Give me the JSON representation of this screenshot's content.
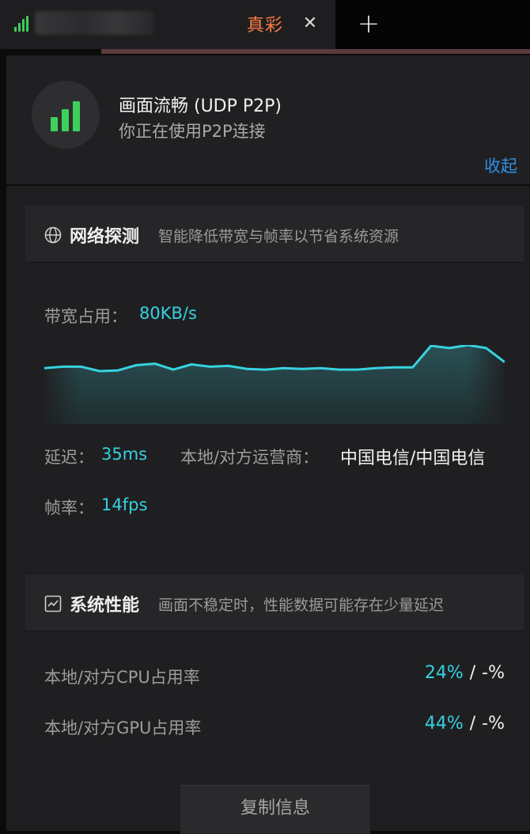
{
  "tab": {
    "title": "真彩",
    "close_glyph": "✕",
    "new_glyph": "+"
  },
  "connection": {
    "title": "画面流畅 (UDP P2P)",
    "subtitle": "你正在使用P2P连接",
    "collapse_label": "收起",
    "signal_icon": "signal-bars-icon",
    "signal_color": "#3fd05a"
  },
  "network": {
    "icon": "globe-icon",
    "title": "网络探测",
    "hint": "智能降低带宽与帧率以节省系统资源",
    "bandwidth_label": "带宽占用：",
    "bandwidth_value": "80KB/s",
    "latency_label": "延迟：",
    "latency_value": "35ms",
    "isp_label": "本地/对方运营商：",
    "isp_value": "中国电信/中国电信",
    "fps_label": "帧率：",
    "fps_value": "14fps",
    "bandwidth_trend": [
      0.54,
      0.56,
      0.56,
      0.5,
      0.51,
      0.58,
      0.6,
      0.52,
      0.59,
      0.56,
      0.57,
      0.53,
      0.52,
      0.54,
      0.53,
      0.54,
      0.52,
      0.52,
      0.54,
      0.55,
      0.55,
      0.84,
      0.81,
      0.85,
      0.81,
      0.62
    ],
    "line_color": "#36d2e0"
  },
  "system": {
    "icon": "trend-chart-icon",
    "title": "系统性能",
    "hint": "画面不稳定时，性能数据可能存在少量延迟",
    "rows": [
      {
        "label": "本地/对方CPU占用率",
        "local": "24%",
        "sep": "/",
        "remote": "-%"
      },
      {
        "label": "本地/对方GPU占用率",
        "local": "44%",
        "sep": "/",
        "remote": "-%"
      }
    ]
  },
  "copy_button_label": "复制信息"
}
